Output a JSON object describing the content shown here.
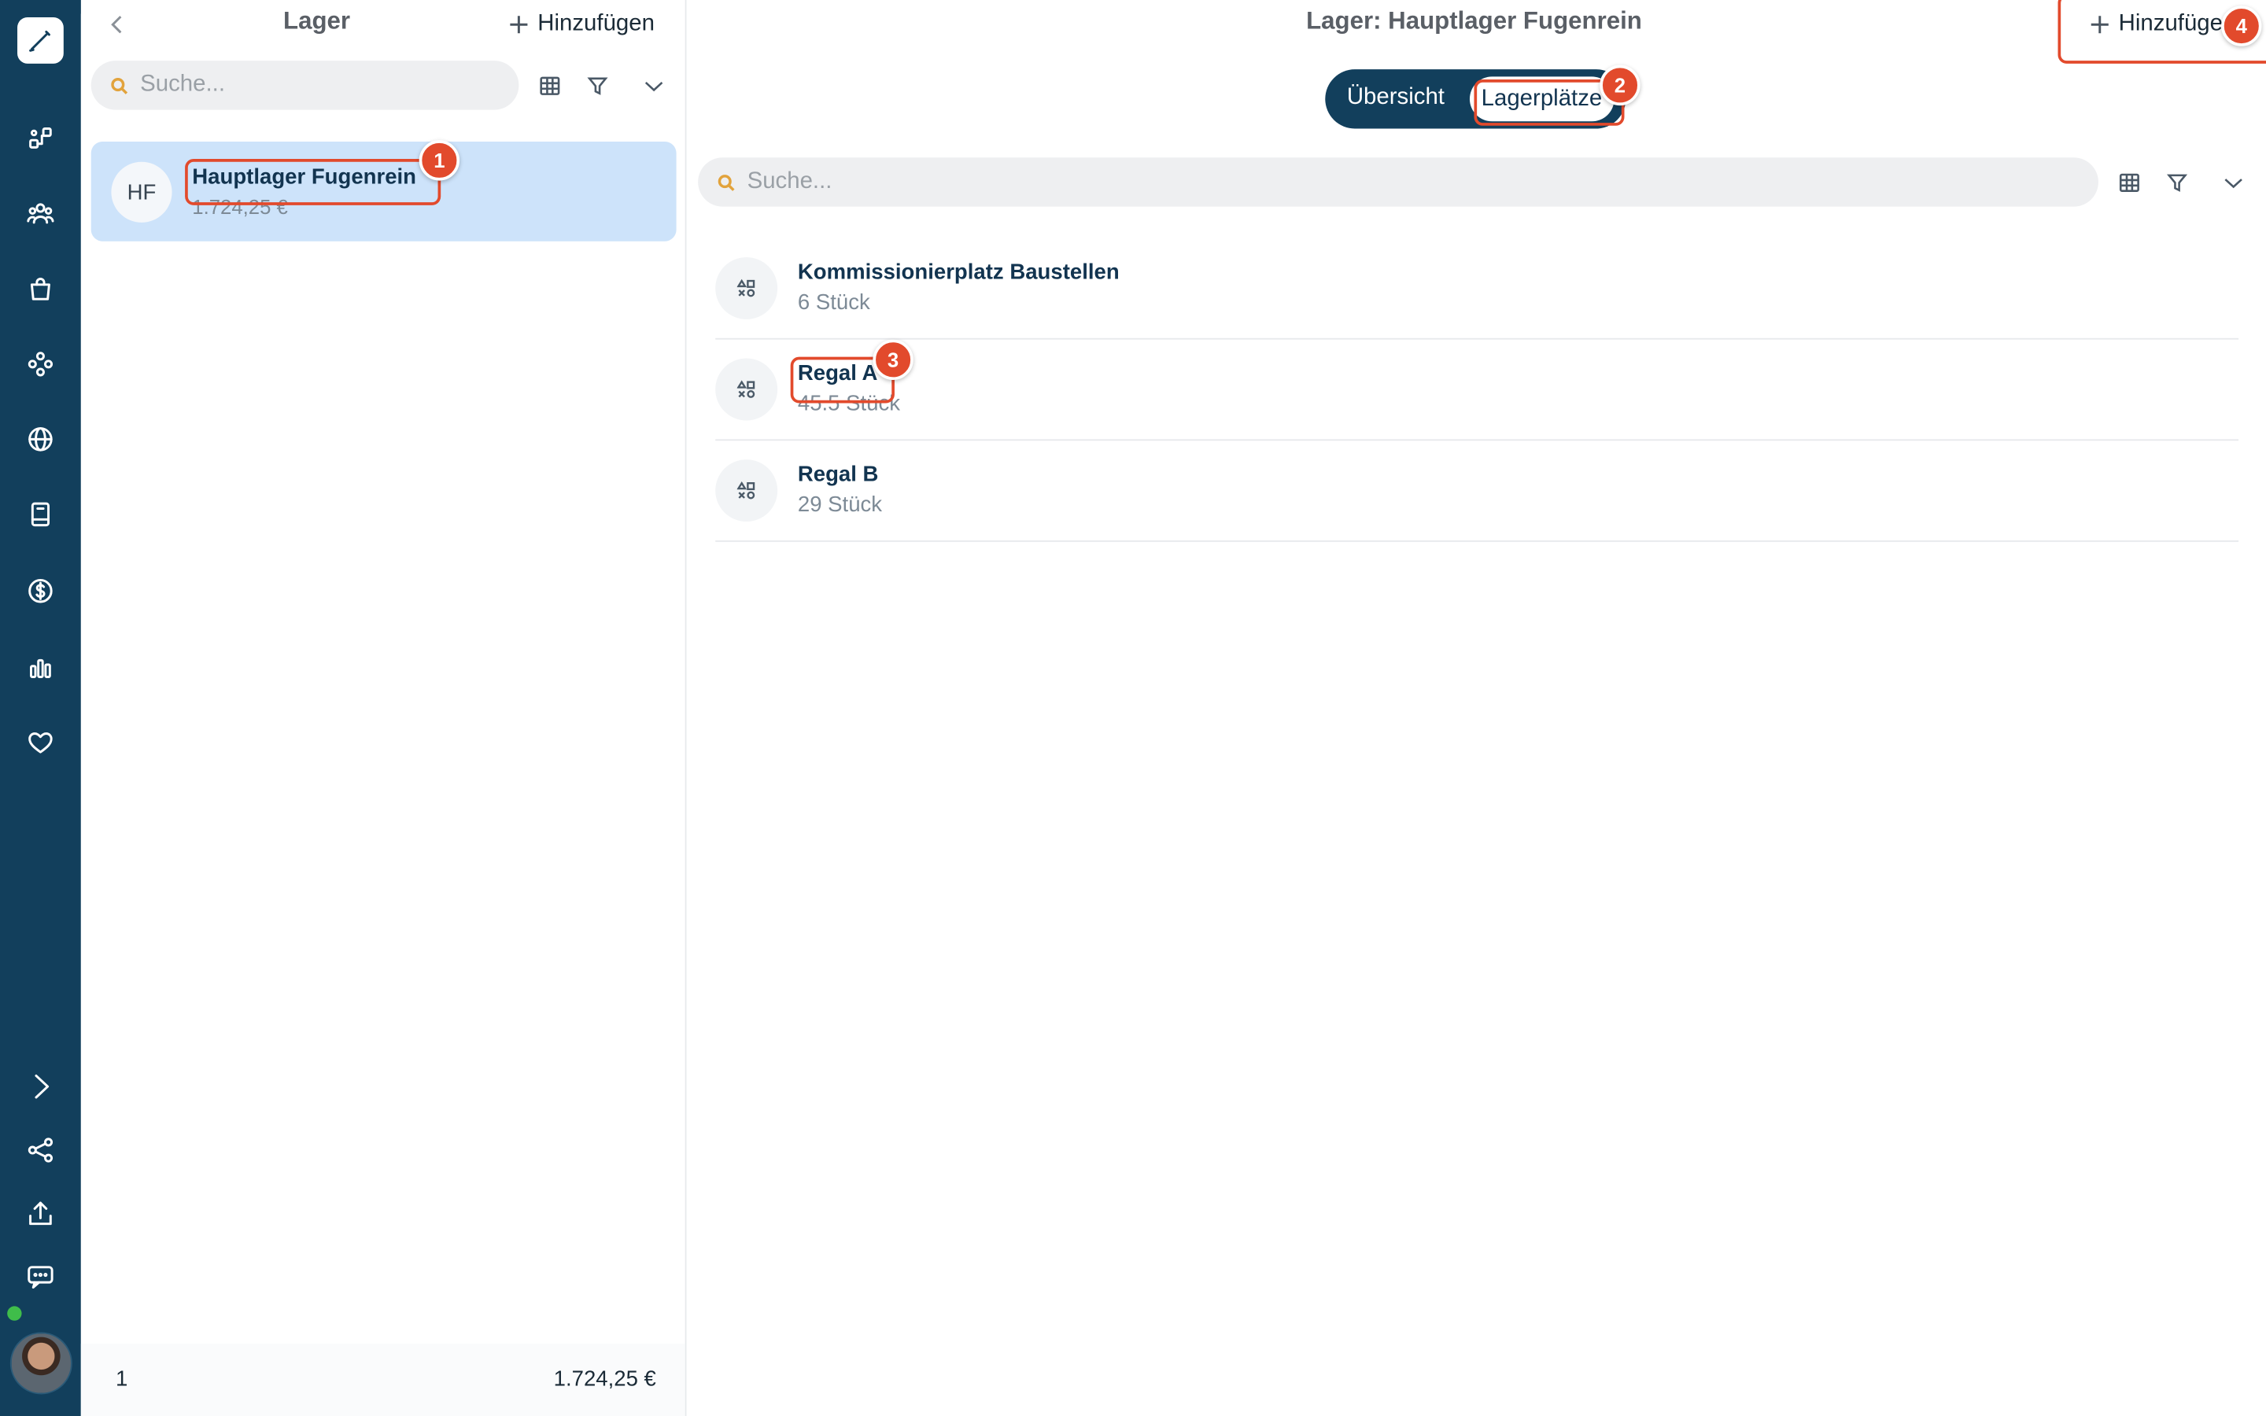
{
  "list_panel": {
    "title": "Lager",
    "add_label": "Hinzufügen",
    "search_placeholder": "Suche...",
    "items": [
      {
        "initials": "HF",
        "name": "Hauptlager Fugenrein",
        "value": "1.724,25 €"
      }
    ],
    "footer": {
      "count": "1",
      "total": "1.724,25 €"
    }
  },
  "detail": {
    "title": "Lager: Hauptlager Fugenrein",
    "add_label": "Hinzufügen",
    "tabs": [
      {
        "label": "Übersicht",
        "active": false
      },
      {
        "label": "Lagerplätze",
        "active": true
      }
    ],
    "search_placeholder": "Suche...",
    "locations": [
      {
        "name": "Kommissionierplatz Baustellen",
        "quantity": "6 Stück"
      },
      {
        "name": "Regal A",
        "quantity": "45.5 Stück"
      },
      {
        "name": "Regal B",
        "quantity": "29 Stück"
      }
    ]
  },
  "annotations": [
    "1",
    "2",
    "3",
    "4"
  ],
  "nav_icons": [
    "workflow-icon",
    "users-icon",
    "shopping-bag-icon",
    "components-icon",
    "globe-icon",
    "book-icon",
    "dollar-icon",
    "bar-chart-icon",
    "heart-icon",
    "chevron-right-icon",
    "share-icon",
    "upload-icon",
    "chat-icon"
  ],
  "colors": {
    "rail": "#123f5c",
    "selected_row": "#cde3fa",
    "annotation": "#e24a2c",
    "search_icon": "#e2a33c"
  }
}
